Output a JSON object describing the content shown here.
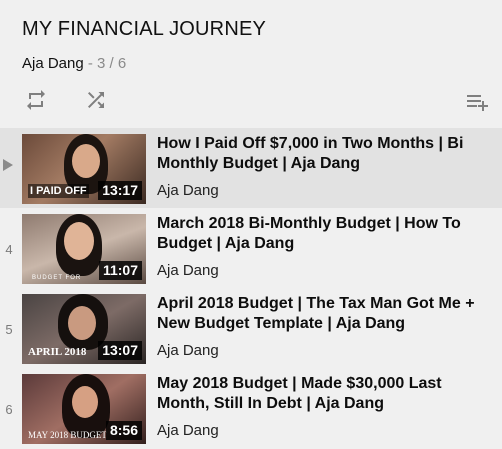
{
  "playlist": {
    "title": "MY FINANCIAL JOURNEY",
    "owner": "Aja Dang",
    "position": " - 3 / 6"
  },
  "controls": {
    "loop_icon": "loop-icon",
    "shuffle_icon": "shuffle-icon",
    "save_icon": "add-to-queue-icon"
  },
  "items": [
    {
      "index": "",
      "now_playing": true,
      "title": "How I Paid Off $7,000 in Two Months | Bi Monthly Budget | Aja Dang",
      "channel": "Aja Dang",
      "duration": "13:17",
      "thumb_text": "I PAID OFF"
    },
    {
      "index": "4",
      "now_playing": false,
      "title": "March 2018 Bi-Monthly Budget | How To Budget | Aja Dang",
      "channel": "Aja Dang",
      "duration": "11:07",
      "thumb_text": "BUDGET FOR"
    },
    {
      "index": "5",
      "now_playing": false,
      "title": "April 2018 Budget | The Tax Man Got Me + New Budget Template | Aja Dang",
      "channel": "Aja Dang",
      "duration": "13:07",
      "thumb_text": "APRIL 2018"
    },
    {
      "index": "6",
      "now_playing": false,
      "title": "May 2018 Budget | Made $30,000 Last Month, Still In Debt | Aja Dang",
      "channel": "Aja Dang",
      "duration": "8:56",
      "thumb_text": "MAY 2018 BUDGET"
    }
  ],
  "colors": {
    "background": "#f0f0f0",
    "active_row": "#e2e2e2",
    "index_gray": "#7a7a7a",
    "icon_gray": "#7f7f7f"
  }
}
